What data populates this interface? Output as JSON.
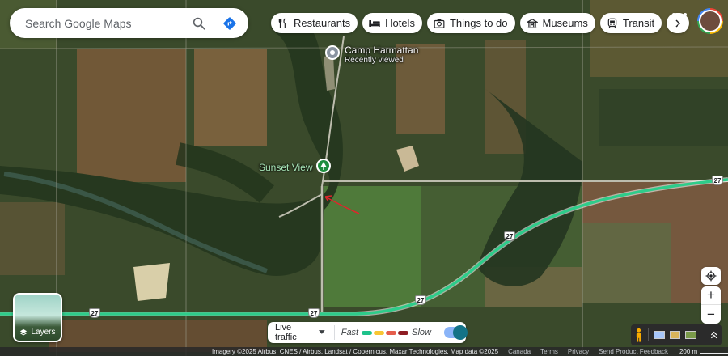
{
  "search": {
    "placeholder": "Search Google Maps"
  },
  "chips": [
    {
      "label": "Restaurants",
      "icon": "restaurant-icon"
    },
    {
      "label": "Hotels",
      "icon": "hotel-icon"
    },
    {
      "label": "Things to do",
      "icon": "camera-icon"
    },
    {
      "label": "Museums",
      "icon": "museum-icon"
    },
    {
      "label": "Transit",
      "icon": "transit-icon"
    }
  ],
  "places": {
    "camp": {
      "name": "Camp Harmattan",
      "sub": "Recently viewed"
    },
    "sunset": {
      "name": "Sunset View"
    }
  },
  "road_shields": [
    "27",
    "27",
    "27",
    "27",
    "27"
  ],
  "layers": {
    "label": "Layers"
  },
  "traffic": {
    "label": "Live traffic",
    "fast": "Fast",
    "slow": "Slow",
    "colors": [
      "#1ec28b",
      "#f7c634",
      "#e55d4c",
      "#8e1c24"
    ]
  },
  "attribution": {
    "imagery": "Imagery ©2025 Airbus, CNES / Airbus, Landsat / Copernicus, Maxar Technologies, Map data ©2025",
    "links": [
      "Canada",
      "Terms",
      "Privacy",
      "Send Product Feedback"
    ],
    "scale": "200 m"
  },
  "colors": {
    "highway": "#2ecc8a",
    "annotation": "#e0252b",
    "pin_gray": "#8a94a0",
    "pin_green": "#1e8e3e"
  }
}
